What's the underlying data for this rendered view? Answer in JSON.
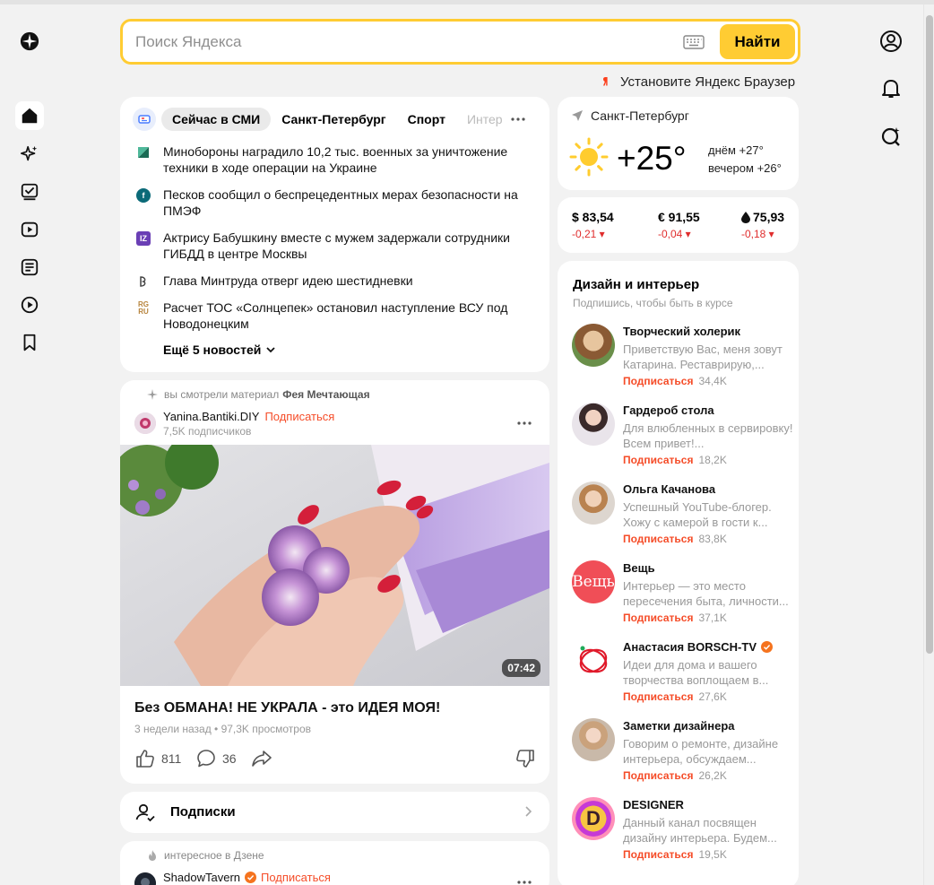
{
  "search": {
    "placeholder": "Поиск Яндекса",
    "button_label": "Найти"
  },
  "browser_promo": "Установите Яндекс Браузер",
  "left_nav": [
    "home",
    "sparkle",
    "tasks",
    "video",
    "articles",
    "clips",
    "bookmarks"
  ],
  "right_nav": [
    "profile",
    "notifications",
    "search-history"
  ],
  "news": {
    "tabs": [
      {
        "label": "Сейчас в СМИ",
        "active": true
      },
      {
        "label": "Санкт-Петербург",
        "active": false
      },
      {
        "label": "Спорт",
        "active": false
      },
      {
        "label": "Интер",
        "active": false
      }
    ],
    "items": [
      {
        "text": "Минобороны наградило 10,2 тыс. военных за уничтожение техники в ходе операции на Украине",
        "source_label": ""
      },
      {
        "text": "Песков сообщил о беспрецедентных мерах безопасности на ПМЭФ",
        "source_label": "f"
      },
      {
        "text": "Актрису Бабушкину вместе с мужем задержали сотрудники ГИБДД в центре Москвы",
        "source_label": "IZ"
      },
      {
        "text": "Глава Минтруда отверг идею шестидневки",
        "source_label": ""
      },
      {
        "text": "Расчет ТОС «Солнцепек» остановил наступление ВСУ под Новодонецким",
        "source_label": "RG RU"
      }
    ],
    "more_label": "Ещё 5 новостей"
  },
  "weather": {
    "city": "Санкт-Петербург",
    "temp": "+25°",
    "day": "днём +27°",
    "evening": "вечером +26°"
  },
  "currency": [
    {
      "label": "$ 83,54",
      "change": "-0,21 ▾"
    },
    {
      "label": "€ 91,55",
      "change": "-0,04 ▾"
    },
    {
      "label": "75,93",
      "change": "-0,18 ▾"
    }
  ],
  "channels": {
    "title": "Дизайн и интерьер",
    "subtitle": "Подпишись, чтобы быть в курсе",
    "subscribe_label": "Подписаться",
    "items": [
      {
        "name": "Творческий холерик",
        "desc": "Приветствую Вас, меня зовут Катарина. Реставрирую,...",
        "count": "34,4K",
        "verified": false
      },
      {
        "name": "Гардероб стола",
        "desc": "Для влюбленных в сервировку! Всем привет!...",
        "count": "18,2K",
        "verified": false
      },
      {
        "name": "Ольга Качанова",
        "desc": "Успешный YouTube-блогер. Хожу с камерой в гости к...",
        "count": "83,8K",
        "verified": false
      },
      {
        "name": "Вещь",
        "desc": "Интерьер — это место пересечения быта, личности...",
        "count": "37,1K",
        "verified": false,
        "logo_text": "Вещь"
      },
      {
        "name": "Анастасия BORSCH-TV",
        "desc": "Идеи для дома и вашего творчества воплощаем в...",
        "count": "27,6K",
        "verified": true
      },
      {
        "name": "Заметки дизайнера",
        "desc": "Говорим о ремонте, дизайне интерьера, обсуждаем...",
        "count": "26,2K",
        "verified": false
      },
      {
        "name": "DESIGNER",
        "desc": "Данный канал посвящен дизайну интерьера. Будем...",
        "count": "19,5K",
        "verified": false,
        "logo_text": "D"
      }
    ]
  },
  "post": {
    "hint_prefix": "вы смотрели материал",
    "hint_channel": "Фея Мечтающая",
    "author": "Yanina.Bantiki.DIY",
    "subscribe_label": "Подписаться",
    "subscribers": "7,5K подписчиков",
    "duration": "07:42",
    "title": "Без ОБМАНА! НЕ УКРАЛА - это ИДЕЯ МОЯ!",
    "meta": "3 недели назад • 97,3K просмотров",
    "likes": "811",
    "comments": "36"
  },
  "subscriptions_label": "Подписки",
  "post2": {
    "hint": "интересное в Дзене",
    "author": "ShadowTavern",
    "subscribe_label": "Подписаться"
  },
  "colors": {
    "accent": "#ffcc33",
    "subscribe": "#f54c28",
    "negative": "#e02d2d"
  }
}
